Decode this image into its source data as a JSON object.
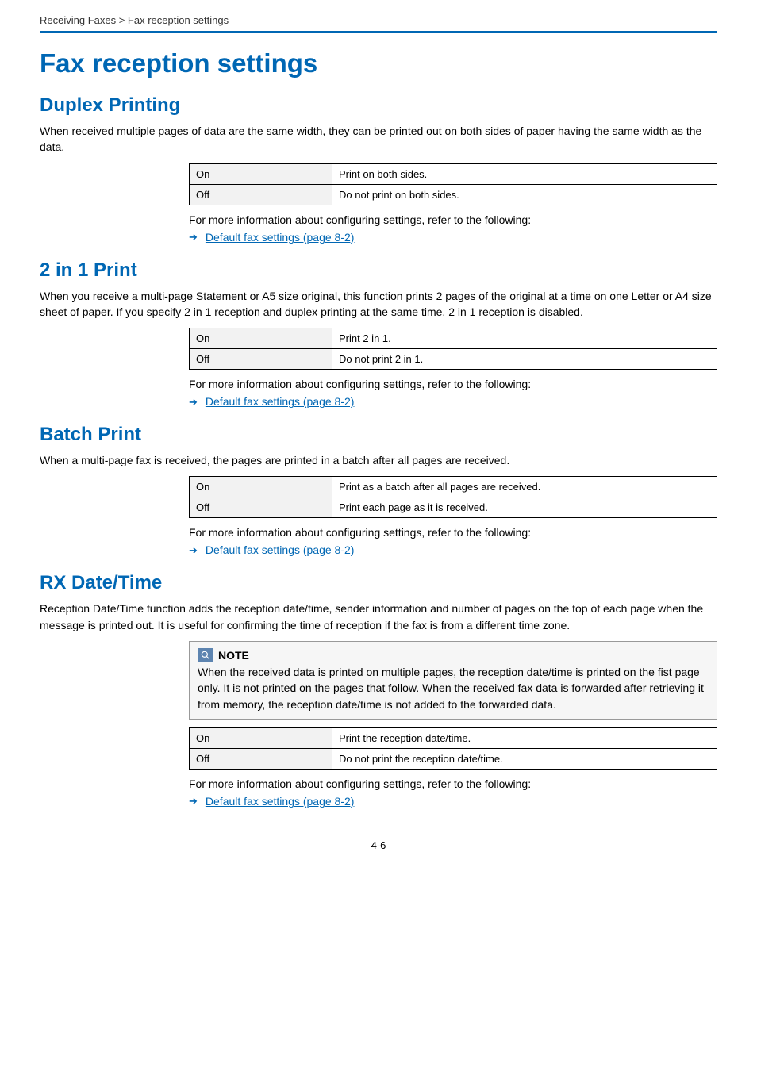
{
  "running_header": "Receiving Faxes > Fax reception settings",
  "page_title": "Fax reception settings",
  "page_number": "4-6",
  "followup_text": "For more information about configuring settings, refer to the following:",
  "link_text": "Default fax settings (page 8-2)",
  "sections": {
    "duplex": {
      "heading": "Duplex Printing",
      "body": "When received multiple pages of data are the same width, they can be printed out on both sides of paper having the same width as the data.",
      "rows": [
        {
          "opt": "On",
          "desc": "Print on both sides."
        },
        {
          "opt": "Off",
          "desc": "Do not print on both sides."
        }
      ]
    },
    "twoinone": {
      "heading": "2 in 1 Print",
      "body": "When you receive a multi-page Statement or A5 size original, this function prints 2 pages of the original at a time on one Letter or A4 size sheet of paper. If you specify 2 in 1 reception and duplex printing at the same time, 2 in 1 reception is disabled.",
      "rows": [
        {
          "opt": "On",
          "desc": "Print 2 in 1."
        },
        {
          "opt": "Off",
          "desc": "Do not print 2 in 1."
        }
      ]
    },
    "batch": {
      "heading": "Batch Print",
      "body": "When a multi-page fax is received, the pages are printed in a batch after all pages are received.",
      "rows": [
        {
          "opt": "On",
          "desc": "Print as a batch after all pages are received."
        },
        {
          "opt": "Off",
          "desc": "Print each page as it is received."
        }
      ]
    },
    "rxdatetime": {
      "heading": "RX Date/Time",
      "body": "Reception Date/Time function adds the reception date/time, sender information and number of pages on the top of each page when the message is printed out. It is useful for confirming the time of reception if the fax is from a different time zone.",
      "note_label": "NOTE",
      "note_body": "When the received data is printed on multiple pages, the reception date/time is printed on the fist page only. It is not printed on the pages that follow. When the received fax data is forwarded after retrieving it from memory, the reception date/time is not added to the forwarded data.",
      "rows": [
        {
          "opt": "On",
          "desc": "Print the reception date/time."
        },
        {
          "opt": "Off",
          "desc": "Do not print the reception date/time."
        }
      ]
    }
  }
}
